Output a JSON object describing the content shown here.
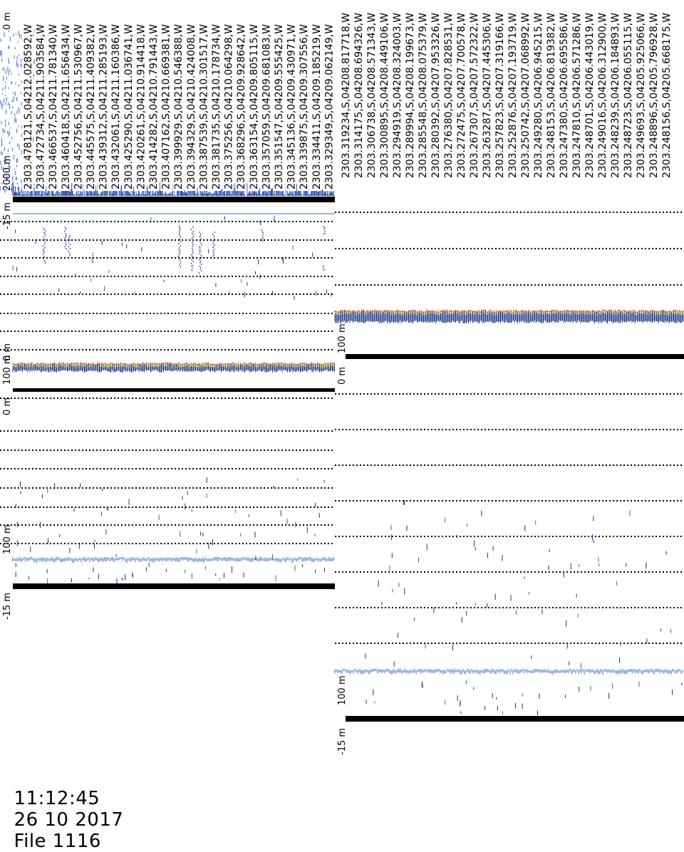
{
  "footer": {
    "time": "11:12:45",
    "date": "26 10 2017",
    "file": "File 1116"
  },
  "colors": {
    "echo_dark": "#1a2f8c",
    "echo_mid": "#3a6fd0",
    "echo_green": "#2e8b2e",
    "echo_red": "#c0392b",
    "echo_yellow": "#d4b800",
    "grid": "#000000"
  },
  "strips": [
    {
      "id": "left-strip",
      "depth_labels": [
        "0 m",
        "2000 m",
        "-15 m",
        "0 m",
        "100 m",
        "0 m",
        "100 m",
        "-15 m"
      ],
      "gps_records": [
        "2303.478121,S,04212.028592,W",
        "2303.472734,S,04211.903584,W",
        "2303.466537,S,04211.781340,W",
        "2303.460418,S,04211.656434,W",
        "2303.452756,S,04211.530967,W",
        "2303.445575,S,04211.409382,W",
        "2303.439312,S,04211.285193,W",
        "2303.432061,S,04211.160386,W",
        "2303.425290,S,04211.036741,W",
        "2303.420261,S,04210.914418,W",
        "2303.414282,S,04210.791443,W",
        "2303.407162,S,04210.669381,W",
        "2303.399929,S,04210.546388,W",
        "2303.394329,S,04210.424008,W",
        "2303.387539,S,04210.301517,W",
        "2303.381735,S,04210.178734,W",
        "2303.375256,S,04210.064298,W",
        "2303.368296,S,04209.928642,W",
        "2303.363154,S,04209.805115,W",
        "2303.357059,S,04209.681083,W",
        "2303.351547,S,04209.555425,W",
        "2303.345136,S,04209.430971,W",
        "2303.339875,S,04209.307556,W",
        "2303.334411,S,04209.185219,W",
        "2303.329349,S,04209.062149,W"
      ]
    },
    {
      "id": "right-strip",
      "depth_labels": [
        "100 m",
        "0 m",
        "0 m",
        "100 m",
        "-15 m"
      ],
      "gps_records": [
        "2303.319234,S,04208.817718,W",
        "2303.314175,S,04208.694326,W",
        "2303.306738,S,04208.571343,W",
        "2303.300895,S,04208.449106,W",
        "2303.294919,S,04208.324003,W",
        "2303.289994,S,04208.199673,W",
        "2303.285548,S,04208.075379,W",
        "2303.280392,S,04207.953326,W",
        "2303.276380,S,04207.828531,W",
        "2303.272475,S,04207.700578,W",
        "2303.267307,S,04207.572322,W",
        "2303.263287,S,04207.445306,W",
        "2303.257823,S,04207.319166,W",
        "2303.252876,S,04207.193719,W",
        "2303.250742,S,04207.068992,W",
        "2303.249280,S,04206.945215,W",
        "2303.248153,S,04206.819382,W",
        "2303.247380,S,04206.695586,W",
        "2303.247810,S,04206.571286,W",
        "2303.248701,S,04206.443019,W",
        "2303.249016,S,04206.312900,W",
        "2303.248239,S,04206.184893,W",
        "2303.248723,S,04206.055115,W",
        "2303.249693,S,04205.925066,W",
        "2303.248896,S,04205.796928,W",
        "2303.248156,S,04205.668175,W"
      ]
    }
  ]
}
